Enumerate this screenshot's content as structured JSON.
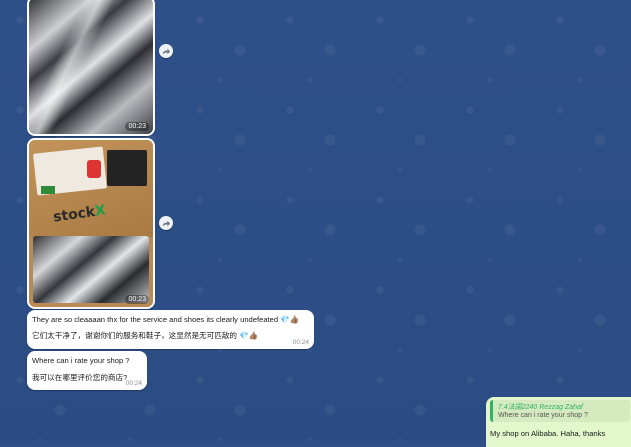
{
  "photos": [
    {
      "time": "00:23"
    },
    {
      "time": "00:23",
      "brand_text": "stock",
      "brand_mark": "X"
    }
  ],
  "messages": [
    {
      "line1": "They are so cleaaaan thx for the service and shoes its clearly undefeated",
      "line2": "它们太干净了，谢谢你们的服务和鞋子，这显然是无可匹敌的",
      "emoji_gem": "💎",
      "emoji_thumb": "👍🏽",
      "time": "00:24"
    },
    {
      "line1": "Where can i rate your shop ?",
      "line2": "我可以在哪里评价您的商店?",
      "time": "00:24"
    }
  ],
  "reply": {
    "quote_author": "7.4法国2240 Rezzag Zahaf",
    "quote_text": "Where can i rate your shop ?",
    "text": "My shop on Alibaba. Haha, thanks"
  },
  "colors": {
    "wallpaper": "#2d4f86",
    "incoming": "#ffffff",
    "outgoing": "#e2f7cb",
    "quote_accent": "#2fb36b"
  },
  "icons": {
    "forward": "forward-arrow-icon"
  }
}
